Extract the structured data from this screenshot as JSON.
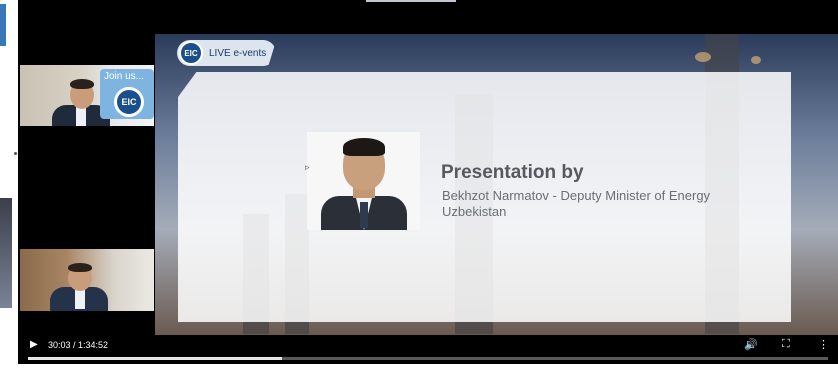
{
  "event": {
    "logo_badge": "EIC",
    "logo_label": "LIVE e-vents"
  },
  "sidebar": {
    "banner_text": "Join us...",
    "banner_badge": "EIC"
  },
  "slide": {
    "title": "Presentation by",
    "subtitle_line1": "Bekhzot Narmatov - Deputy Minister of Energy",
    "subtitle_line2": "Uzbekistan"
  },
  "player": {
    "play_icon": "play-icon",
    "current_time": "30:03",
    "duration": "1:34:52",
    "time_display": "30:03 / 1:34:52",
    "progress_fraction": 0.318,
    "volume_icon": "volume-icon",
    "fullscreen_icon": "fullscreen-icon",
    "more_icon": "more-options-icon"
  },
  "colors": {
    "brand_blue": "#1b4f8c",
    "progress_played": "#e6e6e6",
    "progress_track": "#595959"
  }
}
